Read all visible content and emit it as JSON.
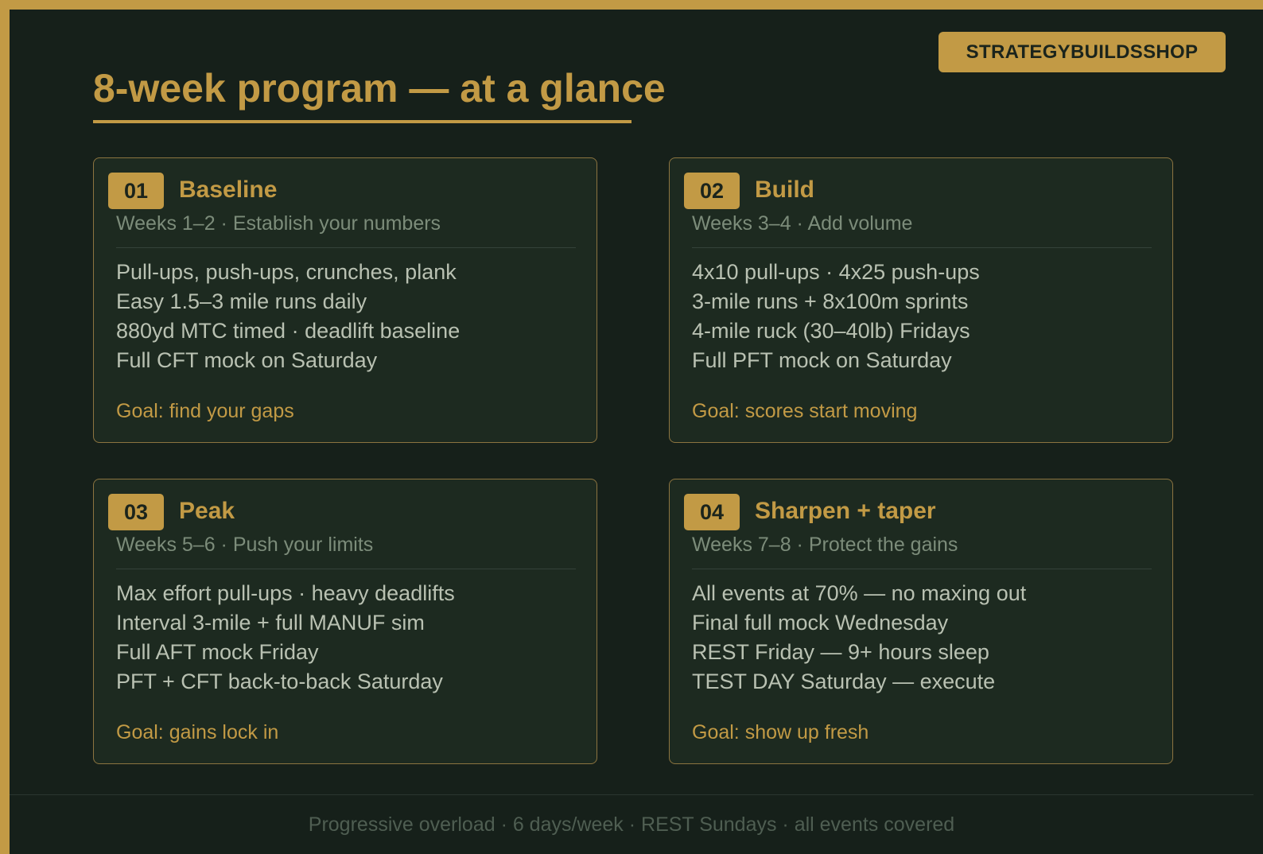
{
  "brand": "STRATEGYBUILDSSHOP",
  "title": "8-week program — at a glance",
  "colors": {
    "accent": "#c29a45",
    "background": "#16201a",
    "card_background": "#1d2a20",
    "body_text": "#b9c1b2",
    "muted_text": "#7c8c7a"
  },
  "phases": [
    {
      "number": "01",
      "name": "Baseline",
      "subtitle": "Weeks 1–2 · Establish your numbers",
      "items": [
        "Pull-ups, push-ups, crunches, plank",
        "Easy 1.5–3 mile runs daily",
        "880yd MTC timed · deadlift baseline",
        "Full CFT mock on Saturday"
      ],
      "goal": "Goal: find your gaps"
    },
    {
      "number": "02",
      "name": "Build",
      "subtitle": "Weeks 3–4 · Add volume",
      "items": [
        "4x10 pull-ups · 4x25 push-ups",
        "3-mile runs + 8x100m sprints",
        "4-mile ruck (30–40lb) Fridays",
        "Full PFT mock on Saturday"
      ],
      "goal": "Goal: scores start moving"
    },
    {
      "number": "03",
      "name": "Peak",
      "subtitle": "Weeks 5–6 · Push your limits",
      "items": [
        "Max effort pull-ups · heavy deadlifts",
        "Interval 3-mile + full MANUF sim",
        "Full AFT mock Friday",
        "PFT + CFT back-to-back Saturday"
      ],
      "goal": "Goal: gains lock in"
    },
    {
      "number": "04",
      "name": "Sharpen + taper",
      "subtitle": "Weeks 7–8 · Protect the gains",
      "items": [
        "All events at 70% — no maxing out",
        "Final full mock Wednesday",
        "REST Friday — 9+ hours sleep",
        "TEST DAY Saturday — execute"
      ],
      "goal": "Goal: show up fresh"
    }
  ],
  "footer": "Progressive overload · 6 days/week · REST Sundays · all events covered"
}
